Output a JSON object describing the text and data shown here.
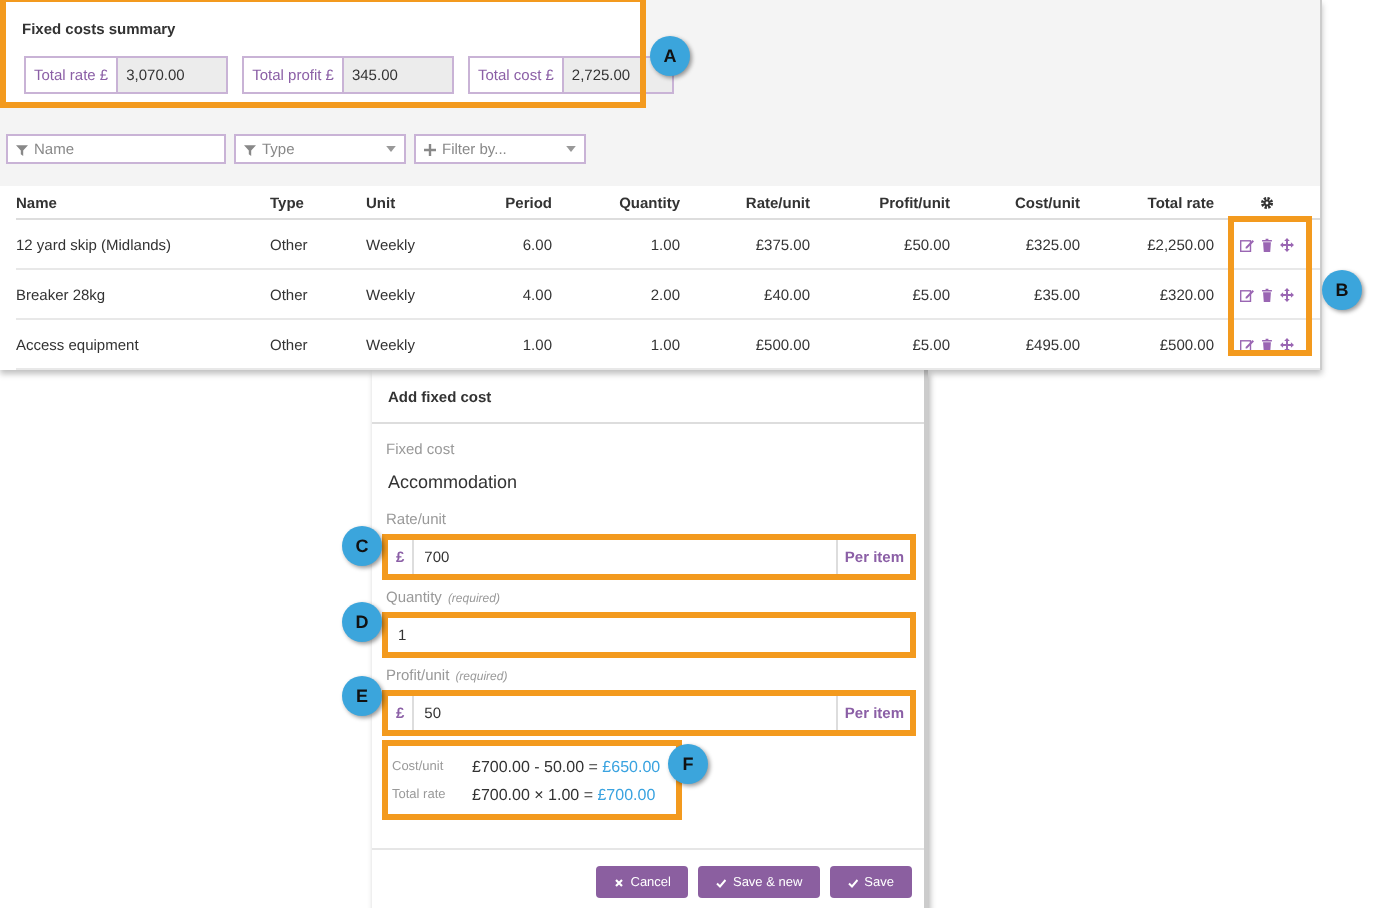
{
  "summary": {
    "title": "Fixed costs summary",
    "totals": [
      {
        "label": "Total rate £",
        "value": "3,070.00"
      },
      {
        "label": "Total profit £",
        "value": "345.00"
      },
      {
        "label": "Total cost £",
        "value": "2,725.00"
      }
    ]
  },
  "filters": [
    {
      "kind": "text",
      "placeholder": "Name"
    },
    {
      "kind": "select",
      "placeholder": "Type"
    },
    {
      "kind": "add",
      "placeholder": "Filter by..."
    }
  ],
  "table": {
    "columns": [
      "Name",
      "Type",
      "Unit",
      "Period",
      "Quantity",
      "Rate/unit",
      "Profit/unit",
      "Cost/unit",
      "Total rate"
    ],
    "rows": [
      {
        "cells": [
          "12 yard skip (Midlands)",
          "Other",
          "Weekly",
          "6.00",
          "1.00",
          "£375.00",
          "£50.00",
          "£325.00",
          "£2,250.00"
        ]
      },
      {
        "cells": [
          "Breaker 28kg",
          "Other",
          "Weekly",
          "4.00",
          "2.00",
          "£40.00",
          "£5.00",
          "£35.00",
          "£320.00"
        ]
      },
      {
        "cells": [
          "Access equipment",
          "Other",
          "Weekly",
          "1.00",
          "1.00",
          "£500.00",
          "£5.00",
          "£495.00",
          "£500.00"
        ]
      }
    ]
  },
  "dialog": {
    "title": "Add fixed cost",
    "fixed_cost_label": "Fixed cost",
    "fixed_cost_value": "Accommodation",
    "fields": [
      {
        "label": "Rate/unit",
        "prefix": "£",
        "value": "700",
        "suffix": "Per item"
      },
      {
        "label": "Quantity",
        "note": "(required)",
        "value": "1"
      },
      {
        "label": "Profit/unit",
        "note": "(required)",
        "prefix": "£",
        "value": "50",
        "suffix": "Per item"
      }
    ],
    "calc": [
      {
        "label": "Cost/unit",
        "expression": "£700.00 - 50.00 =",
        "result": "£650.00"
      },
      {
        "label": "Total rate",
        "expression": "£700.00 × 1.00 =",
        "result": "£700.00"
      }
    ],
    "buttons": [
      {
        "kind": "cancel",
        "label": "Cancel"
      },
      {
        "kind": "save-new",
        "label": "Save & new"
      },
      {
        "kind": "save",
        "label": "Save"
      }
    ]
  },
  "annotations": [
    "A",
    "B",
    "C",
    "D",
    "E",
    "F"
  ]
}
